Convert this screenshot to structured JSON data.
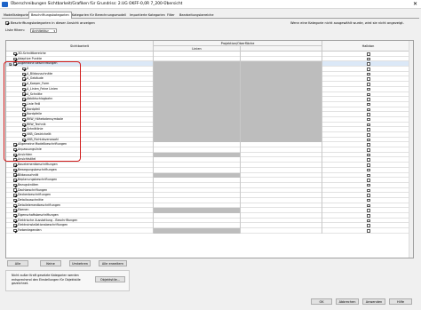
{
  "window": {
    "title": "Überschreibungen Sichtbarkeit/Grafiken für Grundriss: 2.UG OKFF-0,0R 7_200-Übersicht",
    "close": "✕"
  },
  "tabs": [
    {
      "label": "Modellkategorien"
    },
    {
      "label": "Beschriftungskategorien"
    },
    {
      "label": "Kategorien für Berechnungsmodell"
    },
    {
      "label": "Importierte Kategorien"
    },
    {
      "label": "Filter"
    },
    {
      "label": "Bearbeitungsbereiche"
    }
  ],
  "options": {
    "show_label": "Beschriftungskategorien in dieser Ansicht anzeigen",
    "show_checked": true
  },
  "hint": "Wenn eine Kategorie nicht ausgewählt wurde, wird sie nicht angezeigt.",
  "filter": {
    "label": "Liste filtern:",
    "value": "Architektur"
  },
  "columns": {
    "visibility": "Sichtbarkeit",
    "proj": "Projektion/Oberfläche",
    "lines": "Linien",
    "halftone": "Halbton"
  },
  "rows": [
    {
      "label": "3D-Schnittbereiche",
      "checked": true,
      "lvl": 0,
      "exp": "",
      "shade": false
    },
    {
      "label": "Adaptive Punkte",
      "checked": true,
      "lvl": 0,
      "exp": "",
      "shade": false
    },
    {
      "label": "Allgemeine Beschriftungen",
      "checked": true,
      "lvl": 0,
      "exp": "⊟",
      "shade": true,
      "sel": true
    },
    {
      "label": "0",
      "checked": true,
      "lvl": 1,
      "exp": "",
      "shade": true
    },
    {
      "label": "A_Bildausschnitte",
      "checked": true,
      "lvl": 1,
      "exp": "",
      "shade": true
    },
    {
      "label": "A_Gebäude",
      "checked": true,
      "lvl": 1,
      "exp": "",
      "shade": true
    },
    {
      "label": "A_Koeper_Form",
      "checked": true,
      "lvl": 1,
      "exp": "",
      "shade": true
    },
    {
      "label": "A_Linien_Feine Linien",
      "checked": true,
      "lvl": 1,
      "exp": "",
      "shade": true
    },
    {
      "label": "A_Schnitte",
      "checked": true,
      "lvl": 1,
      "exp": "",
      "shade": true
    },
    {
      "label": "Abbildschlagbahn",
      "checked": true,
      "lvl": 1,
      "exp": "",
      "shade": true
    },
    {
      "label": "Linie Feill",
      "checked": true,
      "lvl": 1,
      "exp": "",
      "shade": true
    },
    {
      "label": "Nordpfeil",
      "checked": true,
      "lvl": 1,
      "exp": "",
      "shade": true
    },
    {
      "label": "Nordpfeile",
      "checked": true,
      "lvl": 1,
      "exp": "",
      "shade": true
    },
    {
      "label": "RKW_Höhekotensymbole",
      "checked": true,
      "lvl": 1,
      "exp": "",
      "shade": true
    },
    {
      "label": "RKW_Technik",
      "checked": true,
      "lvl": 1,
      "exp": "",
      "shade": true
    },
    {
      "label": "Schnittlinie",
      "checked": true,
      "lvl": 1,
      "exp": "",
      "shade": true
    },
    {
      "label": "VKB_Gestricheltt",
      "checked": true,
      "lvl": 1,
      "exp": "",
      "shade": true
    },
    {
      "label": "VKB_Richtdsvenswahl",
      "checked": true,
      "lvl": 1,
      "exp": "",
      "shade": true
    },
    {
      "label": "Allgemeine Modellbeschriftungen",
      "checked": true,
      "lvl": 0,
      "exp": "",
      "shade": false
    },
    {
      "label": "Anpassungslinie",
      "checked": true,
      "lvl": 0,
      "exp": "",
      "shade": false
    },
    {
      "label": "Ansichten",
      "checked": true,
      "lvl": 0,
      "exp": "",
      "shade": false,
      "c2shade": true
    },
    {
      "label": "Ansichtstitel",
      "checked": true,
      "lvl": 0,
      "exp": "",
      "shade": false
    },
    {
      "label": "Bauelementbeschriftungen",
      "checked": true,
      "lvl": 0,
      "exp": "",
      "shade": false
    },
    {
      "label": "Bewegungsbeschriftungen",
      "checked": true,
      "lvl": 0,
      "exp": "",
      "shade": false
    },
    {
      "label": "Bildausschnitt",
      "checked": true,
      "lvl": 0,
      "exp": "",
      "shade": false,
      "c2shade": true
    },
    {
      "label": "Beplanungsbeschriftungen",
      "checked": true,
      "lvl": 0,
      "exp": "",
      "shade": false
    },
    {
      "label": "Bezugsknöten",
      "checked": true,
      "lvl": 0,
      "exp": "",
      "shade": false
    },
    {
      "label": "Dachbeschriftungen",
      "checked": true,
      "lvl": 0,
      "exp": "",
      "shade": false
    },
    {
      "label": "Deckenbeschriftungen",
      "checked": true,
      "lvl": 0,
      "exp": "",
      "shade": false
    },
    {
      "label": "Detailausschnitte",
      "checked": true,
      "lvl": 0,
      "exp": "",
      "shade": false
    },
    {
      "label": "Detailelementbeschriftungen",
      "checked": true,
      "lvl": 0,
      "exp": "",
      "shade": false
    },
    {
      "label": "Ebenen",
      "checked": true,
      "lvl": 0,
      "exp": "",
      "shade": false,
      "c2shade": true
    },
    {
      "label": "Eigenschaftsbeschriftungen",
      "checked": true,
      "lvl": 0,
      "exp": "",
      "shade": false
    },
    {
      "label": "Elektrische Ausstattung - Beschriftungen",
      "checked": true,
      "lvl": 0,
      "exp": "",
      "shade": false
    },
    {
      "label": "Elektroinstallationsbeschriftungen",
      "checked": true,
      "lvl": 0,
      "exp": "",
      "shade": false
    },
    {
      "label": "Farbenlegenden",
      "checked": true,
      "lvl": 0,
      "exp": "",
      "shade": false,
      "c2shade": true
    }
  ],
  "buttons": {
    "all": "Alle",
    "none": "Keine",
    "invert": "Umkehren",
    "expand_all": "Alle erweitern"
  },
  "info": "Nicht außer Kraft gesetzte Kategorien werden\nentsprechend den Einstellungen für Objektstile\ngezeichnet.",
  "objectstyles_button": "Objektstile...",
  "dialog_buttons": {
    "ok": "OK",
    "cancel": "Abbrechen",
    "apply": "Anwenden",
    "help": "Hilfe"
  }
}
